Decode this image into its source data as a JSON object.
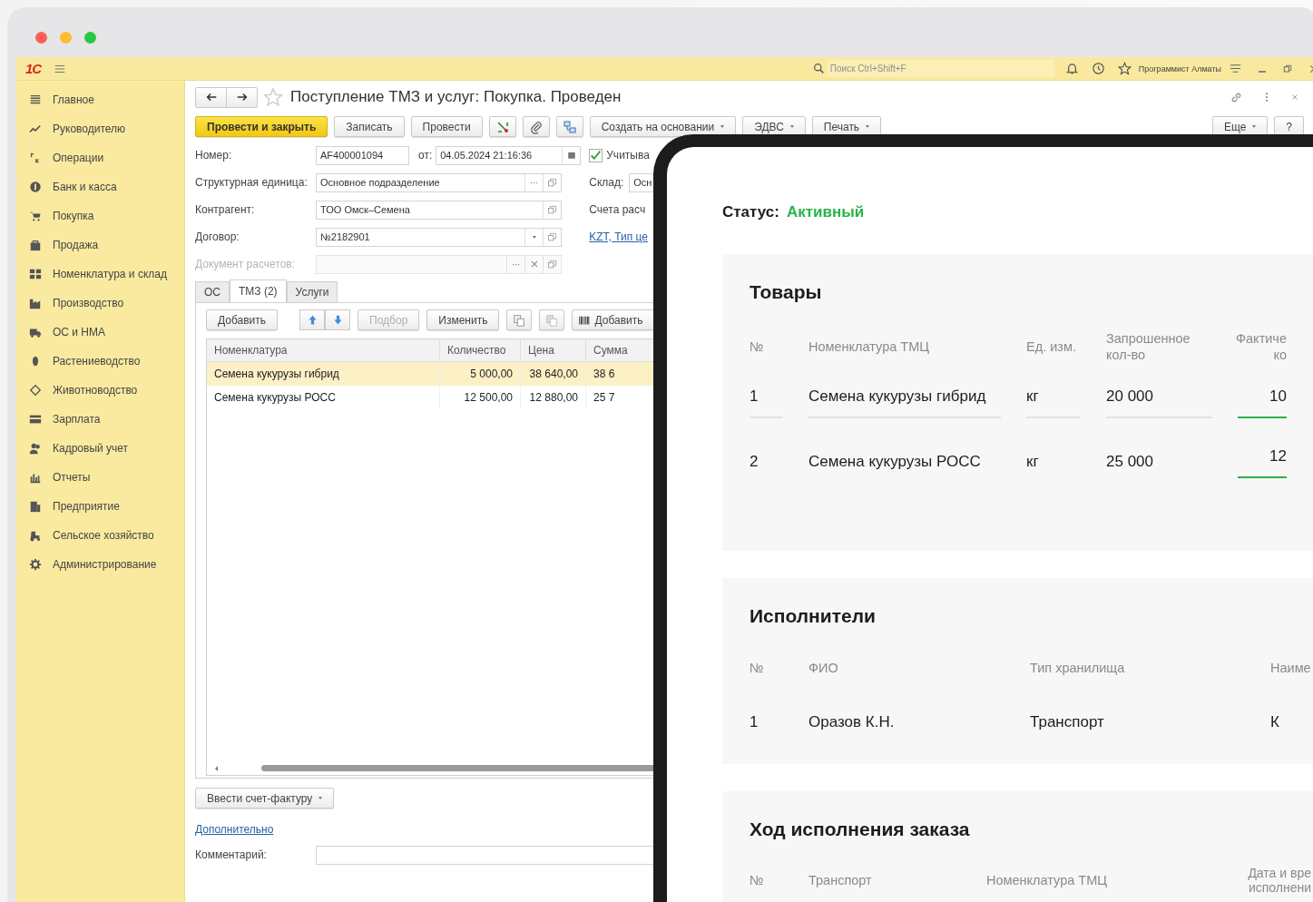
{
  "topbar": {
    "logo": "1С",
    "search": {
      "placeholder": "Поиск Ctrl+Shift+F"
    },
    "user": "Программист Алматы"
  },
  "sidebar": {
    "items": [
      {
        "label": "Главное"
      },
      {
        "label": "Руководителю"
      },
      {
        "label": "Операции"
      },
      {
        "label": "Банк и касса"
      },
      {
        "label": "Покупка"
      },
      {
        "label": "Продажа"
      },
      {
        "label": "Номенклатура и склад"
      },
      {
        "label": "Производство"
      },
      {
        "label": "ОС и НМА"
      },
      {
        "label": "Растениеводство"
      },
      {
        "label": "Животноводство"
      },
      {
        "label": "Зарплата"
      },
      {
        "label": "Кадровый учет"
      },
      {
        "label": "Отчеты"
      },
      {
        "label": "Предприятие"
      },
      {
        "label": "Сельское хозяйство"
      },
      {
        "label": "Администрирование"
      }
    ]
  },
  "document": {
    "title": "Поступление ТМЗ и услуг: Покупка. Проведен",
    "favorite": false
  },
  "toolbar": [
    {
      "kind": "primary",
      "label": "Провести и закрыть"
    },
    {
      "kind": "button",
      "label": "Записать"
    },
    {
      "kind": "button",
      "label": "Провести"
    },
    {
      "kind": "icon"
    },
    {
      "kind": "icon"
    },
    {
      "kind": "icon"
    },
    {
      "kind": "dropdown",
      "label": "Создать на основании"
    },
    {
      "kind": "dropdown",
      "label": "ЭДВС"
    },
    {
      "kind": "dropdown",
      "label": "Печать"
    }
  ],
  "toolbar_right": [
    {
      "kind": "dropdown",
      "label": "Еще"
    },
    {
      "kind": "button",
      "label": "?"
    }
  ],
  "fields": {
    "number": {
      "label": "Номер:",
      "value": "AF400001094"
    },
    "date": {
      "label": "от:",
      "value": "04.05.2024 21:16:36"
    },
    "account_checkbox": {
      "label": "Учитыва",
      "checked": true
    },
    "unit": {
      "label": "Структурная единица:",
      "value": "Основное подразделение"
    },
    "counterparty": {
      "label": "Контрагент:",
      "value": "ТОО Омск–Семена"
    },
    "contract": {
      "label": "Договор:",
      "value": "№2182901"
    },
    "settlement_document": {
      "label": "Документ расчетов:",
      "disabled": true
    },
    "warehouse": {
      "label": "Склад:",
      "value": "Осн"
    },
    "accounts": {
      "label": "Счета расч",
      "link": "KZT, Тип це"
    }
  },
  "tabs": [
    {
      "label": "ОС",
      "selected": false
    },
    {
      "label": "ТМЗ (2)",
      "selected": true
    },
    {
      "label": "Услуги",
      "selected": false
    }
  ],
  "table_toolbar": [
    {
      "kind": "button",
      "label": "Добавить",
      "disabled": false
    },
    {
      "kind": "arrows"
    },
    {
      "kind": "button",
      "label": "Подбор",
      "disabled": true
    },
    {
      "kind": "button",
      "label": "Изменить",
      "disabled": false
    },
    {
      "kind": "icon",
      "disabled": false
    },
    {
      "kind": "icon",
      "disabled": true
    },
    {
      "kind": "barcode",
      "label": "Добавить",
      "disabled": false
    }
  ],
  "table": {
    "columns": [
      "Номенклатура",
      "Количество",
      "Цена",
      "Сумма"
    ],
    "rows": [
      {
        "selected": true,
        "cells": [
          "Семена кукурузы гибрид",
          "5 000,00",
          "38 640,00",
          "38 6"
        ]
      },
      {
        "selected": false,
        "cells": [
          "Семена кукурузы РОСС",
          "12 500,00",
          "12 880,00",
          "25 7"
        ]
      }
    ]
  },
  "invoice_button": "Ввести счет-фактуру",
  "more_link": "Дополнительно",
  "comment": {
    "label": "Комментарий:"
  },
  "tablet": {
    "status": {
      "label": "Статус:",
      "value": "Активный",
      "color": "#2bb24c"
    },
    "sections": [
      {
        "title": "Товары",
        "kind": "goods",
        "columns": [
          "№",
          "Номенклатура ТМЦ",
          "Ед. изм.",
          "Запрошенное кол-во",
          "Фактиче ко"
        ],
        "rows": [
          [
            "1",
            "Семена кукурузы гибрид",
            "кг",
            "20 000",
            "10"
          ],
          [
            "2",
            "Семена кукурузы РОСС",
            "кг",
            "25 000",
            "12"
          ]
        ]
      },
      {
        "title": "Исполнители",
        "kind": "people",
        "columns": [
          "№",
          "ФИО",
          "Тип хранилища",
          "Наиме"
        ],
        "rows": [
          [
            "1",
            "Оразов К.Н.",
            "Транспорт",
            "К"
          ]
        ]
      },
      {
        "title": "Ход исполнения заказа",
        "kind": "progress",
        "columns": [
          "№",
          "Транспорт",
          "Номенклатура ТМЦ",
          "Дата и вре исполнени"
        ]
      }
    ]
  }
}
